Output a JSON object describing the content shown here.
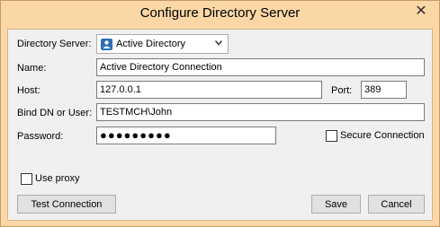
{
  "dialog": {
    "title": "Configure Directory Server",
    "close_glyph": "✕"
  },
  "form": {
    "directory_server": {
      "label": "Directory Server:",
      "value": "Active Directory",
      "icon": "active-directory-icon"
    },
    "name": {
      "label": "Name:",
      "value": "Active Directory Connection"
    },
    "host": {
      "label": "Host:",
      "value": "127.0.0.1"
    },
    "port": {
      "label": "Port:",
      "value": "389"
    },
    "bind_dn": {
      "label": "Bind DN or User:",
      "value": "TESTMCH\\John"
    },
    "password": {
      "label": "Password:",
      "value": "●●●●●●●●●"
    },
    "secure_connection": {
      "label": "Secure Connection",
      "checked": false
    },
    "use_proxy": {
      "label": "Use proxy",
      "checked": false
    }
  },
  "buttons": {
    "test_connection": "Test Connection",
    "save": "Save",
    "cancel": "Cancel"
  }
}
